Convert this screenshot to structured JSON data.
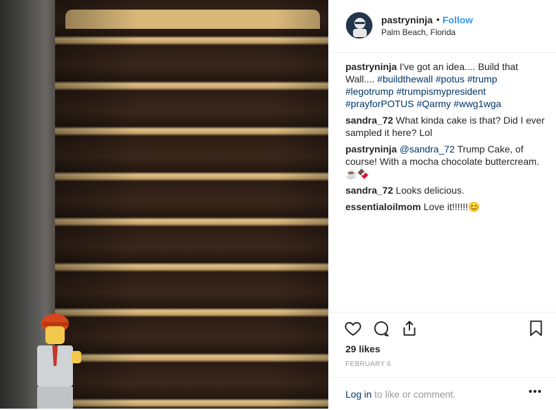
{
  "post": {
    "username": "pastryninja",
    "separator": "•",
    "follow_label": "Follow",
    "location": "Palm Beach, Florida"
  },
  "comments": [
    {
      "user": "pastryninja",
      "parts": [
        {
          "text": "I've got an idea.... Build that Wall.... ",
          "tag": false
        },
        {
          "text": "#buildthewall",
          "tag": true
        },
        {
          "text": " ",
          "tag": false
        },
        {
          "text": "#potus",
          "tag": true
        },
        {
          "text": " ",
          "tag": false
        },
        {
          "text": "#trump",
          "tag": true
        },
        {
          "text": " ",
          "tag": false
        },
        {
          "text": "#legotrump",
          "tag": true
        },
        {
          "text": " ",
          "tag": false
        },
        {
          "text": "#trumpismypresident",
          "tag": true
        },
        {
          "text": " ",
          "tag": false
        },
        {
          "text": "#prayforPOTUS",
          "tag": true
        },
        {
          "text": " ",
          "tag": false
        },
        {
          "text": "#Qarmy",
          "tag": true
        },
        {
          "text": " ",
          "tag": false
        },
        {
          "text": "#wwg1wga",
          "tag": true
        }
      ]
    },
    {
      "user": "sandra_72",
      "parts": [
        {
          "text": "What kinda cake is that? Did I ever sampled it here? Lol",
          "tag": false
        }
      ]
    },
    {
      "user": "pastryninja",
      "parts": [
        {
          "text": "@sandra_72",
          "tag": true
        },
        {
          "text": " Trump Cake, of course! With a mocha chocolate buttercream.☕🍫",
          "tag": false
        }
      ]
    },
    {
      "user": "sandra_72",
      "parts": [
        {
          "text": "Looks delicious.",
          "tag": false
        }
      ]
    },
    {
      "user": "essentialoilmom",
      "parts": [
        {
          "text": "Love it!!!!!!😊",
          "tag": false
        }
      ]
    }
  ],
  "actions": {
    "like_icon": "heart-icon",
    "comment_icon": "comment-icon",
    "share_icon": "share-icon",
    "save_icon": "bookmark-icon",
    "likes": "29 likes",
    "date": "FEBRUARY 6"
  },
  "footer": {
    "login_link": "Log in",
    "login_rest": " to like or comment.",
    "more": "•••"
  },
  "colors": {
    "link": "#3897f0",
    "tag": "#003569",
    "muted": "#999999"
  }
}
